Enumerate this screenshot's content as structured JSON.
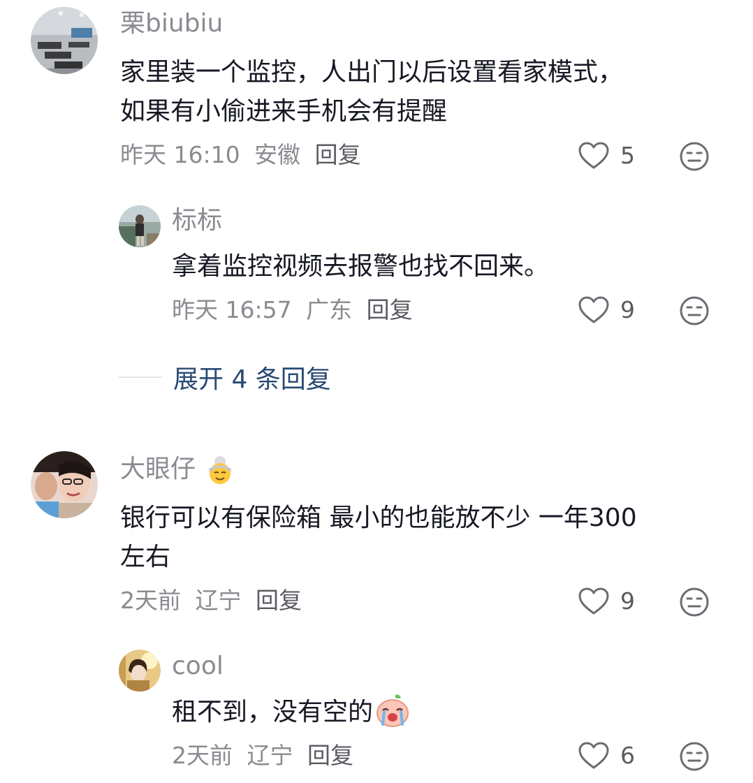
{
  "comments": [
    {
      "username": "栗biubiu",
      "content_line1": "家里装一个监控，人出门以后设置看家模式，",
      "content_line2": "如果有小偷进来手机会有提醒",
      "time": "昨天 16:10",
      "location": "安徽",
      "reply_label": "回复",
      "likes": "5",
      "replies": [
        {
          "username": "标标",
          "content": "拿着监控视频去报警也找不回来。",
          "time": "昨天 16:57",
          "location": "广东",
          "reply_label": "回复",
          "likes": "9"
        }
      ],
      "expand_label": "展开 4 条回复"
    },
    {
      "username": "大眼仔",
      "username_emoji": "grandmother-emoji",
      "content_line1": "银行可以有保险箱 最小的也能放不少 一年300",
      "content_line2": "左右",
      "time": "2天前",
      "location": "辽宁",
      "reply_label": "回复",
      "likes": "9",
      "replies": [
        {
          "username": "cool",
          "content": "租不到，没有空的",
          "content_emoji": "crying-peach-sticker",
          "time": "2天前",
          "location": "辽宁",
          "reply_label": "回复",
          "likes": "6"
        }
      ]
    }
  ],
  "icons": {
    "like": "heart-outline-icon",
    "dislike": "meh-face-icon"
  },
  "colors": {
    "text_primary": "#161823",
    "text_secondary": "#8a8b91",
    "expand_link": "#2a4a73"
  }
}
